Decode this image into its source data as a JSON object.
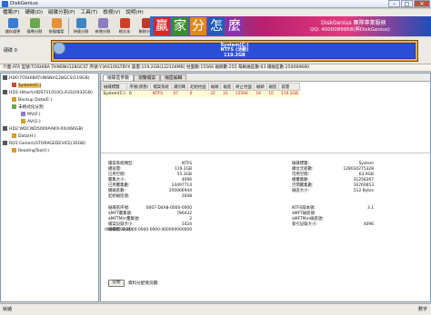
{
  "window": {
    "title": "DiskGenius  "
  },
  "menu": [
    "檔案(F)",
    "硬碟(D)",
    "磁碟分割(P)",
    "工具(T)",
    "檢視(V)",
    "說明(H)"
  ],
  "toolbar": [
    {
      "label": "儲存變更",
      "color": "#3a7bd5"
    },
    {
      "label": "搜尋分割",
      "color": "#6aa84f"
    },
    {
      "label": "恢復檔案",
      "color": "#e69138"
    },
    {
      "label": "快速分割",
      "color": "#3d85c6"
    },
    {
      "label": "新增分割",
      "color": "#8e7cc3"
    },
    {
      "label": "格式化",
      "color": "#cc4125"
    },
    {
      "label": "刪除分割",
      "color": "#c0392b"
    },
    {
      "label": "備份分割",
      "color": "#45818e"
    }
  ],
  "banner": {
    "tiles": [
      "贏",
      "家",
      "分",
      "怎",
      "麼"
    ],
    "line1": "DiskGenius 團隊專業服務",
    "line2": "QQ: 4000089958(與DiskGenius)"
  },
  "disk_label": {
    "line1": "硬碟 0",
    "line2": ""
  },
  "partition": {
    "name": "System(C:)",
    "fs": "NTFS (活動)",
    "size": "119.2GB"
  },
  "info_line": "介面:ATA  型號:TOSHIBA THNSNH128GCST  序號:Y3AS10SLTBYX  容量:119.2GB(122104MB)  柱面數:15566  磁頭數:255  每軌磁區數:63  總磁區數:250069680",
  "tree": [
    {
      "text": "HD0:TOSHIBATHNSNH128GCS(119GB)",
      "indent": 2,
      "color": "#555",
      "sel": false
    },
    {
      "text": "System(C:)",
      "indent": 12,
      "color": "#c94b3c",
      "sel": true
    },
    {
      "text": "HD1:HitachiHDS721010CLA332(932GB)",
      "indent": 2,
      "color": "#555",
      "sel": false
    },
    {
      "text": "Backup Data(E:)",
      "indent": 12,
      "color": "#d59e2c",
      "sel": false
    },
    {
      "text": "未格式化分割",
      "indent": 12,
      "color": "#6aa84f",
      "sel": false
    },
    {
      "text": "MV(F:)",
      "indent": 22,
      "color": "#8e7cc3",
      "sel": false
    },
    {
      "text": "AV(G:)",
      "indent": 22,
      "color": "#d59e2c",
      "sel": false
    },
    {
      "text": "HD2:WDCWD5000AAKX-00(466GB)",
      "indent": 2,
      "color": "#555",
      "sel": false
    },
    {
      "text": "Data(H:)",
      "indent": 12,
      "color": "#d59e2c",
      "sel": false
    },
    {
      "text": "RD1:GenericSTORAGEDEVICE(30GB)",
      "indent": 2,
      "color": "#555",
      "sel": false
    },
    {
      "text": "ReadingTool(I:)",
      "indent": 12,
      "color": "#d59e2c",
      "sel": false
    }
  ],
  "tabs": [
    "磁碟區參數",
    "瀏覽檔案",
    "磁區編輯"
  ],
  "grid": {
    "headers": [
      "磁碟標籤",
      "序號(狀態)",
      "檔案系統",
      "識別碼",
      "起始柱面",
      "磁頭",
      "磁區",
      "終止柱面",
      "磁頭",
      "磁區",
      "容量"
    ],
    "row": [
      "System(C:)",
      "0",
      "NTFS",
      "07",
      "0",
      "32",
      "33",
      "15566",
      "18",
      "10",
      "119.2GB"
    ]
  },
  "details_left": [
    {
      "k": "檔案系統類型:",
      "v": "NTFS"
    },
    {
      "k": "總容量:",
      "v": "119.2GB"
    },
    {
      "k": "已用空間:",
      "v": "55.3GB"
    },
    {
      "k": "叢集大小:",
      "v": "4096"
    },
    {
      "k": "已用叢集數:",
      "v": "14497714"
    },
    {
      "k": "總磁區數:",
      "v": "250066944"
    },
    {
      "k": "起始磁區號:",
      "v": "2048"
    }
  ],
  "details_right": [
    {
      "k": "磁碟標籤:",
      "v": "System"
    },
    {
      "k": "總位元組數:",
      "v": "128034275328"
    },
    {
      "k": "可用空間:",
      "v": "63.9GB"
    },
    {
      "k": "總叢集數:",
      "v": "31258367"
    },
    {
      "k": "空閒叢集數:",
      "v": "16760653"
    },
    {
      "k": "磁區大小:",
      "v": "512 Bytes"
    }
  ],
  "details2_left": [
    {
      "k": "磁碟區序號:",
      "v": "0007-D4A8-0000-0000"
    },
    {
      "k": "$MFT叢集號:",
      "v": "786432"
    },
    {
      "k": "$MFTMirr叢集號:",
      "v": "2"
    },
    {
      "k": "檔案記錄大小:",
      "v": "1024"
    },
    {
      "k": "磁碟區 GUID:",
      "v": "00000000-0000-0000-0000-000000000000"
    }
  ],
  "details2_right": [
    {
      "k": "NTFS版本號:",
      "v": "3.1"
    },
    {
      "k": "$MFT磁區號:",
      "v": ""
    },
    {
      "k": "$MFTMirr磁區號:",
      "v": ""
    },
    {
      "k": "索引記錄大小:",
      "v": "4096"
    }
  ],
  "analyze": {
    "button": "分析",
    "link": "資料分配情況圖:"
  },
  "status": {
    "left": "就緒",
    "right": "數字"
  }
}
